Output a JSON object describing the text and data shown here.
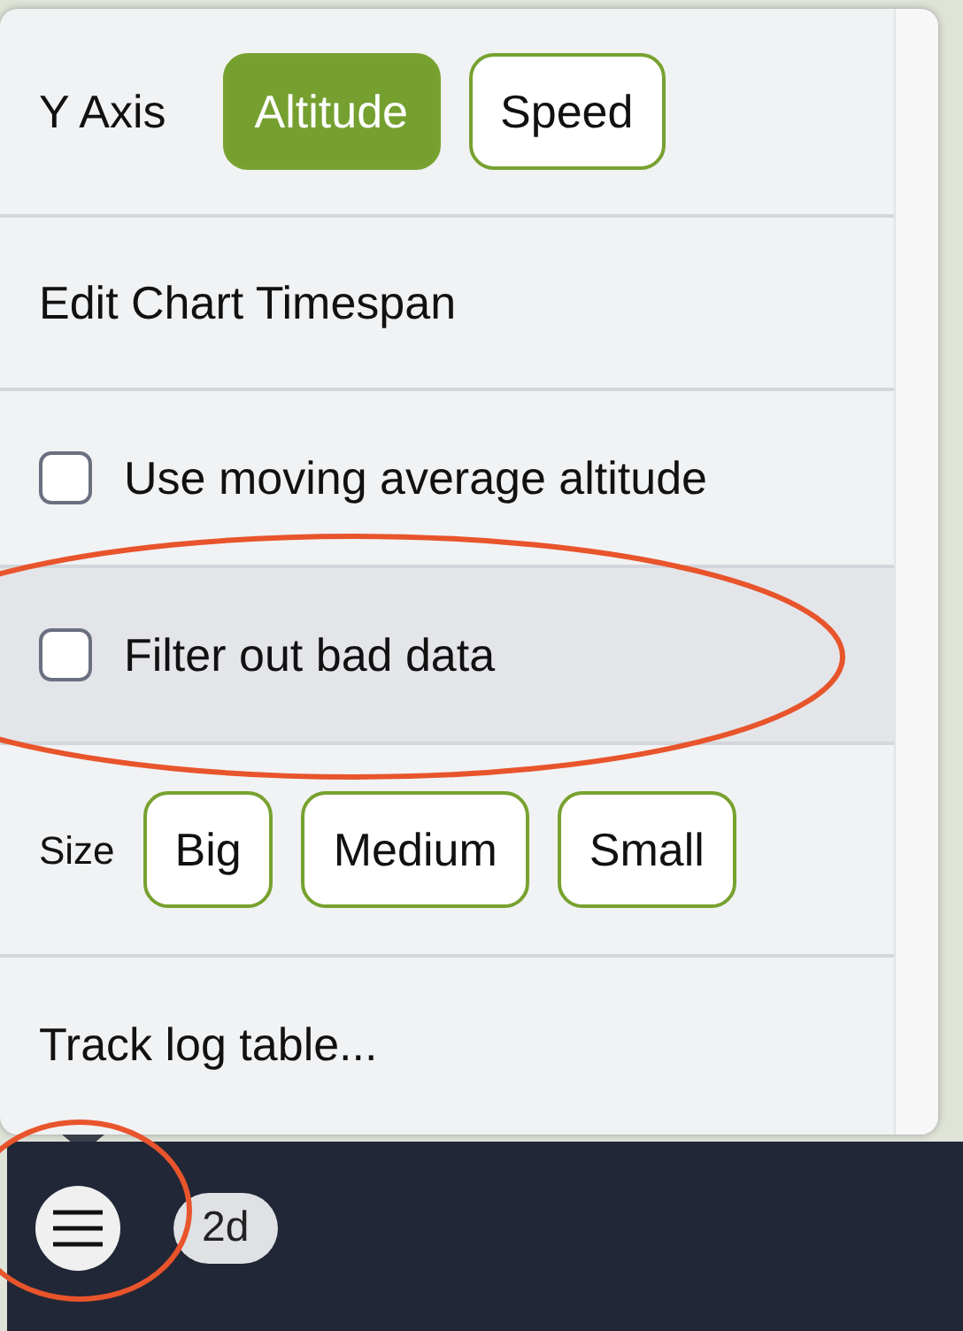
{
  "menu": {
    "y_axis": {
      "label": "Y Axis",
      "options": [
        {
          "label": "Altitude",
          "selected": true
        },
        {
          "label": "Speed",
          "selected": false
        }
      ]
    },
    "timespan": {
      "label": "Edit Chart Timespan"
    },
    "checks": [
      {
        "label": "Use moving average altitude",
        "checked": false,
        "highlighted": false
      },
      {
        "label": "Filter out bad data",
        "checked": false,
        "highlighted": true
      }
    ],
    "size": {
      "label": "Size",
      "options": [
        {
          "label": "Big",
          "selected": false
        },
        {
          "label": "Medium",
          "selected": false
        },
        {
          "label": "Small",
          "selected": false
        }
      ]
    },
    "track_log": {
      "label": "Track log table..."
    }
  },
  "toolbar": {
    "badge": "2d"
  }
}
